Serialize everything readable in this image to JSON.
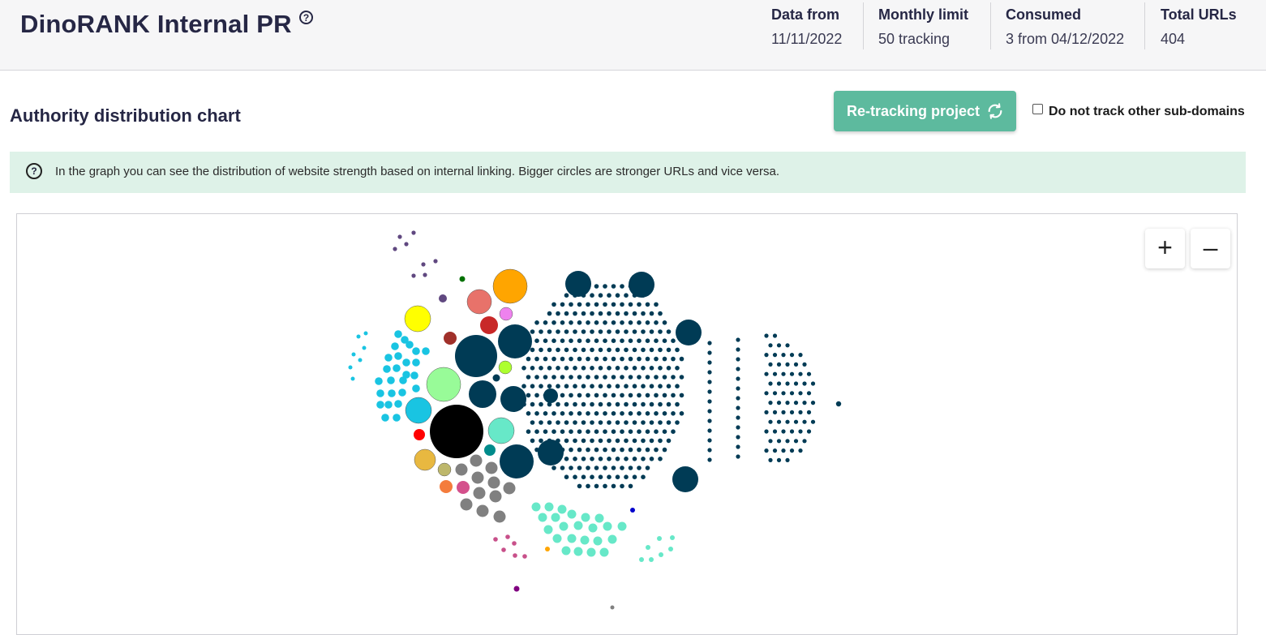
{
  "header": {
    "title": "DinoRANK Internal PR",
    "help_icon": "?",
    "stats": [
      {
        "label": "Data from",
        "value": "11/11/2022"
      },
      {
        "label": "Monthly limit",
        "value": "50 tracking"
      },
      {
        "label": "Consumed",
        "value": "3 from 04/12/2022"
      },
      {
        "label": "Total URLs",
        "value": "404"
      }
    ]
  },
  "section": {
    "title": "Authority distribution chart",
    "retrack_button": "Re-tracking project",
    "refresh_icon": "refresh-icon",
    "checkbox_label": "Do not track other sub-domains",
    "checkbox_checked": false
  },
  "info": {
    "icon": "?",
    "message": "In the graph you can see the distribution of website strength based on internal linking. Bigger circles are stronger URLs and vice versa."
  },
  "graph": {
    "zoom_in": "+",
    "zoom_out": "–",
    "colors": {
      "navy": "#003b55",
      "black": "#000000",
      "cyan": "#19c4e2",
      "gray": "#808080",
      "aqua": "#67e8c8",
      "orange": "#ffa500",
      "salmon": "#e8726a",
      "yellow": "#ffff00",
      "violet": "#ee82ee",
      "red": "#c82828",
      "brown": "#a0302a",
      "lightgreen": "#98fb98",
      "limegreen": "#adff2f",
      "pureRed": "#ff0000",
      "gold": "#e8b840",
      "olive": "#bdb76b",
      "coral": "#f47c3c",
      "pink": "#d4508c",
      "teal": "#008b8b",
      "purple": "#604880",
      "green": "#007000",
      "blue": "#0000cc",
      "magenta": "#800080",
      "rose": "#c8508a",
      "amber": "#ffa500"
    }
  }
}
